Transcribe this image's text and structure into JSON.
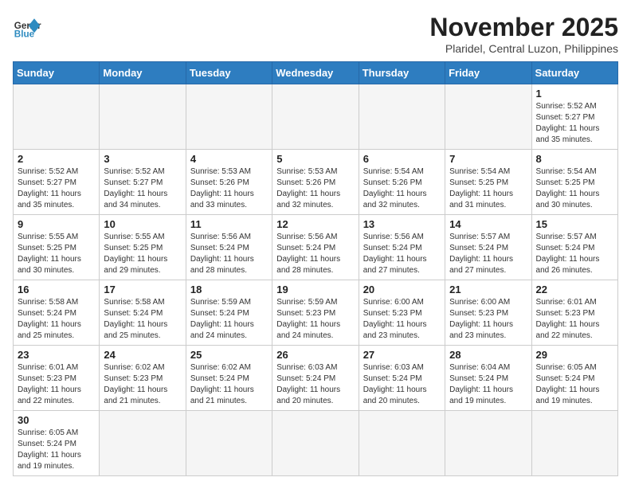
{
  "header": {
    "logo_general": "General",
    "logo_blue": "Blue",
    "month_title": "November 2025",
    "subtitle": "Plaridel, Central Luzon, Philippines"
  },
  "weekdays": [
    "Sunday",
    "Monday",
    "Tuesday",
    "Wednesday",
    "Thursday",
    "Friday",
    "Saturday"
  ],
  "weeks": [
    [
      {
        "day": "",
        "info": ""
      },
      {
        "day": "",
        "info": ""
      },
      {
        "day": "",
        "info": ""
      },
      {
        "day": "",
        "info": ""
      },
      {
        "day": "",
        "info": ""
      },
      {
        "day": "",
        "info": ""
      },
      {
        "day": "1",
        "info": "Sunrise: 5:52 AM\nSunset: 5:27 PM\nDaylight: 11 hours\nand 35 minutes."
      }
    ],
    [
      {
        "day": "2",
        "info": "Sunrise: 5:52 AM\nSunset: 5:27 PM\nDaylight: 11 hours\nand 35 minutes."
      },
      {
        "day": "3",
        "info": "Sunrise: 5:52 AM\nSunset: 5:27 PM\nDaylight: 11 hours\nand 34 minutes."
      },
      {
        "day": "4",
        "info": "Sunrise: 5:53 AM\nSunset: 5:26 PM\nDaylight: 11 hours\nand 33 minutes."
      },
      {
        "day": "5",
        "info": "Sunrise: 5:53 AM\nSunset: 5:26 PM\nDaylight: 11 hours\nand 32 minutes."
      },
      {
        "day": "6",
        "info": "Sunrise: 5:54 AM\nSunset: 5:26 PM\nDaylight: 11 hours\nand 32 minutes."
      },
      {
        "day": "7",
        "info": "Sunrise: 5:54 AM\nSunset: 5:25 PM\nDaylight: 11 hours\nand 31 minutes."
      },
      {
        "day": "8",
        "info": "Sunrise: 5:54 AM\nSunset: 5:25 PM\nDaylight: 11 hours\nand 30 minutes."
      }
    ],
    [
      {
        "day": "9",
        "info": "Sunrise: 5:55 AM\nSunset: 5:25 PM\nDaylight: 11 hours\nand 30 minutes."
      },
      {
        "day": "10",
        "info": "Sunrise: 5:55 AM\nSunset: 5:25 PM\nDaylight: 11 hours\nand 29 minutes."
      },
      {
        "day": "11",
        "info": "Sunrise: 5:56 AM\nSunset: 5:24 PM\nDaylight: 11 hours\nand 28 minutes."
      },
      {
        "day": "12",
        "info": "Sunrise: 5:56 AM\nSunset: 5:24 PM\nDaylight: 11 hours\nand 28 minutes."
      },
      {
        "day": "13",
        "info": "Sunrise: 5:56 AM\nSunset: 5:24 PM\nDaylight: 11 hours\nand 27 minutes."
      },
      {
        "day": "14",
        "info": "Sunrise: 5:57 AM\nSunset: 5:24 PM\nDaylight: 11 hours\nand 27 minutes."
      },
      {
        "day": "15",
        "info": "Sunrise: 5:57 AM\nSunset: 5:24 PM\nDaylight: 11 hours\nand 26 minutes."
      }
    ],
    [
      {
        "day": "16",
        "info": "Sunrise: 5:58 AM\nSunset: 5:24 PM\nDaylight: 11 hours\nand 25 minutes."
      },
      {
        "day": "17",
        "info": "Sunrise: 5:58 AM\nSunset: 5:24 PM\nDaylight: 11 hours\nand 25 minutes."
      },
      {
        "day": "18",
        "info": "Sunrise: 5:59 AM\nSunset: 5:24 PM\nDaylight: 11 hours\nand 24 minutes."
      },
      {
        "day": "19",
        "info": "Sunrise: 5:59 AM\nSunset: 5:23 PM\nDaylight: 11 hours\nand 24 minutes."
      },
      {
        "day": "20",
        "info": "Sunrise: 6:00 AM\nSunset: 5:23 PM\nDaylight: 11 hours\nand 23 minutes."
      },
      {
        "day": "21",
        "info": "Sunrise: 6:00 AM\nSunset: 5:23 PM\nDaylight: 11 hours\nand 23 minutes."
      },
      {
        "day": "22",
        "info": "Sunrise: 6:01 AM\nSunset: 5:23 PM\nDaylight: 11 hours\nand 22 minutes."
      }
    ],
    [
      {
        "day": "23",
        "info": "Sunrise: 6:01 AM\nSunset: 5:23 PM\nDaylight: 11 hours\nand 22 minutes."
      },
      {
        "day": "24",
        "info": "Sunrise: 6:02 AM\nSunset: 5:23 PM\nDaylight: 11 hours\nand 21 minutes."
      },
      {
        "day": "25",
        "info": "Sunrise: 6:02 AM\nSunset: 5:24 PM\nDaylight: 11 hours\nand 21 minutes."
      },
      {
        "day": "26",
        "info": "Sunrise: 6:03 AM\nSunset: 5:24 PM\nDaylight: 11 hours\nand 20 minutes."
      },
      {
        "day": "27",
        "info": "Sunrise: 6:03 AM\nSunset: 5:24 PM\nDaylight: 11 hours\nand 20 minutes."
      },
      {
        "day": "28",
        "info": "Sunrise: 6:04 AM\nSunset: 5:24 PM\nDaylight: 11 hours\nand 19 minutes."
      },
      {
        "day": "29",
        "info": "Sunrise: 6:05 AM\nSunset: 5:24 PM\nDaylight: 11 hours\nand 19 minutes."
      }
    ],
    [
      {
        "day": "30",
        "info": "Sunrise: 6:05 AM\nSunset: 5:24 PM\nDaylight: 11 hours\nand 19 minutes."
      },
      {
        "day": "",
        "info": ""
      },
      {
        "day": "",
        "info": ""
      },
      {
        "day": "",
        "info": ""
      },
      {
        "day": "",
        "info": ""
      },
      {
        "day": "",
        "info": ""
      },
      {
        "day": "",
        "info": ""
      }
    ]
  ]
}
